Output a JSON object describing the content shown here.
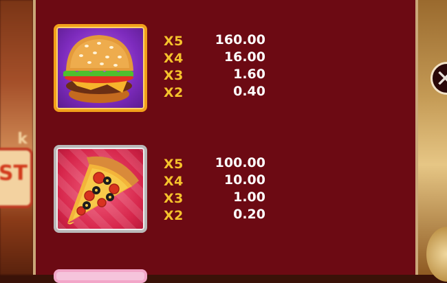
{
  "paytable": {
    "symbols": [
      {
        "name": "burger",
        "frame_color": "#f2a01a",
        "rows": [
          {
            "mult": "X5",
            "value": "160.00"
          },
          {
            "mult": "X4",
            "value": "16.00"
          },
          {
            "mult": "X3",
            "value": "1.60"
          },
          {
            "mult": "X2",
            "value": "0.40"
          }
        ]
      },
      {
        "name": "pizza",
        "frame_color": "#b9b9b9",
        "rows": [
          {
            "mult": "X5",
            "value": "100.00"
          },
          {
            "mult": "X4",
            "value": "10.00"
          },
          {
            "mult": "X3",
            "value": "1.00"
          },
          {
            "mult": "X2",
            "value": "0.20"
          }
        ]
      }
    ]
  },
  "close_button": {
    "icon": "close-icon",
    "glyph": "✕"
  },
  "background_logo": {
    "fragment": "ST",
    "top_fragment": "k"
  },
  "colors": {
    "panel": "#6c0a13",
    "multiplier": "#f5c22c",
    "payout": "#ffffff",
    "border": "#caa778"
  }
}
